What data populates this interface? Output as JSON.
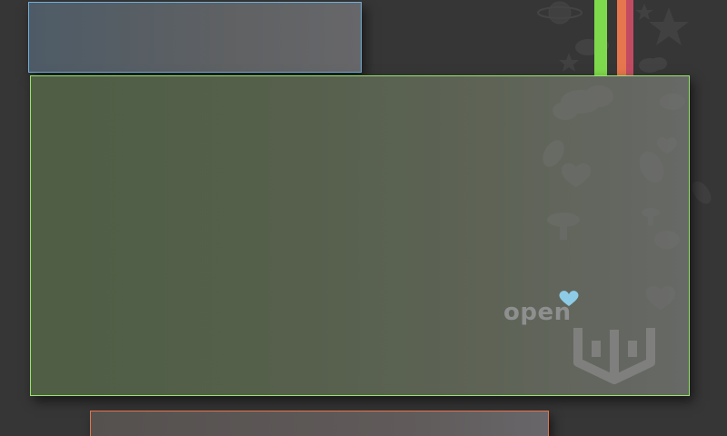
{
  "logo": {
    "text": "open",
    "heart_color": "#8ecbe6"
  },
  "colors": {
    "background": "#363636",
    "top_panel_border": "#6fb0dc",
    "main_panel_border": "#96e56a",
    "bottom_panel_border": "#e3754e",
    "stripe_green": "#7fd94c",
    "stripe_orange": "#e6764d",
    "stripe_red": "#c24b62"
  },
  "wallpaper": {
    "icons": [
      "star-icon",
      "cloud-icon",
      "heart-icon",
      "mushroom-icon",
      "leaf-icon",
      "bird-icon",
      "planet-icon"
    ]
  }
}
